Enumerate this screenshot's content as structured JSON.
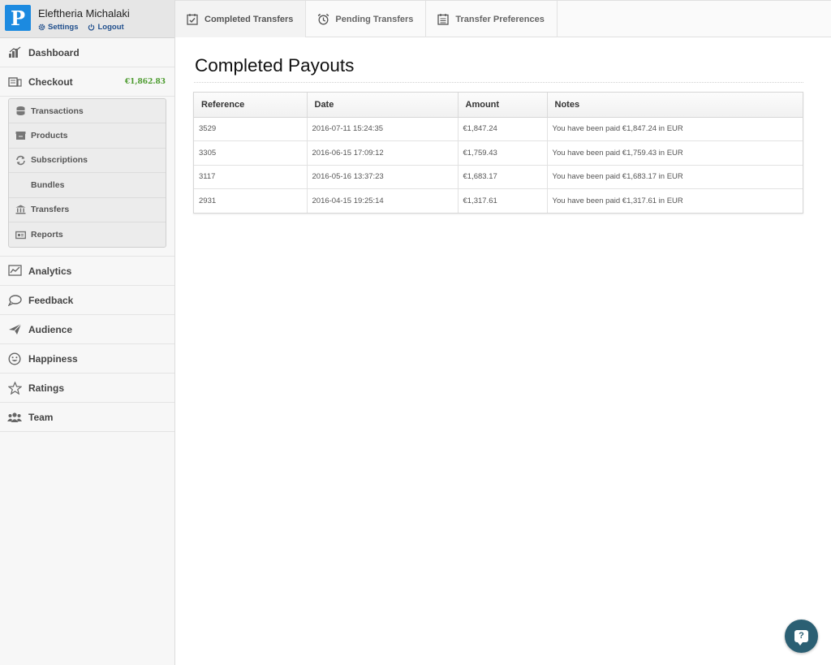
{
  "user": {
    "name": "Eleftheria Michalaki",
    "logo_letter": "P",
    "settings_label": "Settings",
    "logout_label": "Logout"
  },
  "sidebar": {
    "dashboard": "Dashboard",
    "checkout": "Checkout",
    "checkout_balance": "€1,862.83",
    "sub": {
      "transactions": "Transactions",
      "products": "Products",
      "subscriptions": "Subscriptions",
      "bundles": "Bundles",
      "transfers": "Transfers",
      "reports": "Reports"
    },
    "analytics": "Analytics",
    "feedback": "Feedback",
    "audience": "Audience",
    "happiness": "Happiness",
    "ratings": "Ratings",
    "team": "Team"
  },
  "tabs": {
    "completed": "Completed Transfers",
    "pending": "Pending Transfers",
    "preferences": "Transfer Preferences"
  },
  "main": {
    "title": "Completed Payouts",
    "columns": {
      "reference": "Reference",
      "date": "Date",
      "amount": "Amount",
      "notes": "Notes"
    },
    "rows": [
      {
        "reference": "3529",
        "date": "2016-07-11 15:24:35",
        "amount": "€1,847.24",
        "notes": "You have been paid €1,847.24 in EUR"
      },
      {
        "reference": "3305",
        "date": "2016-06-15 17:09:12",
        "amount": "€1,759.43",
        "notes": "You have been paid €1,759.43 in EUR"
      },
      {
        "reference": "3117",
        "date": "2016-05-16 13:37:23",
        "amount": "€1,683.17",
        "notes": "You have been paid €1,683.17 in EUR"
      },
      {
        "reference": "2931",
        "date": "2016-04-15 19:25:14",
        "amount": "€1,317.61",
        "notes": "You have been paid €1,317.61 in EUR"
      }
    ]
  },
  "help": {
    "glyph": "?"
  },
  "colors": {
    "accent": "#1c8ae0",
    "balance": "#4a9a2c",
    "help": "#2b5f73"
  }
}
